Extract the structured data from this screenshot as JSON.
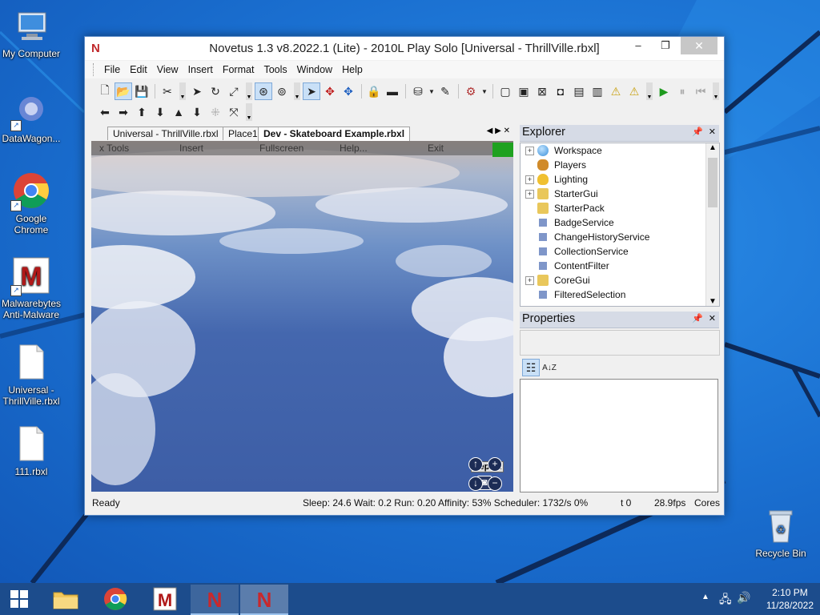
{
  "desktop": {
    "icons": [
      {
        "label": "My Computer"
      },
      {
        "label": "DataWagon..."
      },
      {
        "label": "Google Chrome"
      },
      {
        "label": "Malwarebytes Anti-Malware"
      },
      {
        "label": "Universal - ThrillVille.rbxl"
      },
      {
        "label": "111.rbxl"
      },
      {
        "label": "Recycle Bin"
      }
    ]
  },
  "window": {
    "title": "Novetus 1.3 v8.2022.1 (Lite) - 2010L Play Solo [Universal - ThrillVille.rbxl]",
    "logo": "N",
    "close_glyph": "✕",
    "restore_glyph": "❐",
    "minimize_glyph": "–"
  },
  "menu": [
    "File",
    "Edit",
    "View",
    "Insert",
    "Format",
    "Tools",
    "Window",
    "Help"
  ],
  "doc_tabs": [
    "Universal - ThrillVille.rbxl",
    "Place1",
    "Dev - Skateboard Example.rbxl"
  ],
  "viewport": {
    "game_menu": [
      "x Tools",
      "Insert",
      "Fullscreen",
      "Help...",
      "Exit"
    ],
    "report_label": "Report"
  },
  "explorer": {
    "title": "Explorer",
    "pin": "🖈",
    "close": "✕",
    "items": [
      {
        "label": "Workspace",
        "expandable": true,
        "icon": "globe-icon",
        "color": "#3a8fd9"
      },
      {
        "label": "Players",
        "expandable": false,
        "icon": "players-icon",
        "color": "#d08a2a"
      },
      {
        "label": "Lighting",
        "expandable": true,
        "icon": "bulb-icon",
        "color": "#f0c030"
      },
      {
        "label": "StarterGui",
        "expandable": true,
        "icon": "folder-icon",
        "color": "#e9c75b"
      },
      {
        "label": "StarterPack",
        "expandable": false,
        "icon": "folder-icon",
        "color": "#e9c75b"
      },
      {
        "label": "BadgeService",
        "expandable": false,
        "icon": "service-icon",
        "color": "#7f96c9"
      },
      {
        "label": "ChangeHistoryService",
        "expandable": false,
        "icon": "service-icon",
        "color": "#7f96c9"
      },
      {
        "label": "CollectionService",
        "expandable": false,
        "icon": "service-icon",
        "color": "#7f96c9"
      },
      {
        "label": "ContentFilter",
        "expandable": false,
        "icon": "service-icon",
        "color": "#7f96c9"
      },
      {
        "label": "CoreGui",
        "expandable": true,
        "icon": "folder-icon",
        "color": "#e9c75b"
      },
      {
        "label": "FilteredSelection",
        "expandable": false,
        "icon": "service-icon",
        "color": "#7f96c9"
      }
    ]
  },
  "properties": {
    "title": "Properties",
    "sort_alpha_label": "A↓Z"
  },
  "status": {
    "ready": "Ready",
    "stats": "Sleep: 24.6 Wait: 0.2 Run: 0.20 Affinity: 53% Scheduler: 1732/s 0%",
    "t": "t 0",
    "fps": "28.9fps",
    "cores": "Cores"
  },
  "taskbar": {
    "time": "2:10 PM",
    "date": "11/28/2022"
  }
}
